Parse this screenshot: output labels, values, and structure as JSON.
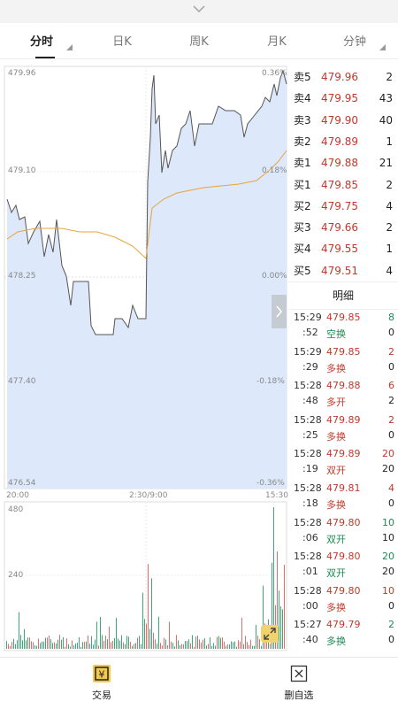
{
  "tabs": {
    "items": [
      {
        "label": "分时"
      },
      {
        "label": "日K"
      },
      {
        "label": "周K"
      },
      {
        "label": "月K"
      },
      {
        "label": "分钟"
      }
    ]
  },
  "chart": {
    "price_labels": [
      "479.96",
      "479.10",
      "478.25",
      "477.40",
      "476.54"
    ],
    "pct_labels": [
      "0.36%",
      "0.18%",
      "0.00%",
      "-0.18%",
      "-0.36%"
    ],
    "time_labels": [
      "20:00",
      "2:30/9:00",
      "15:30"
    ],
    "volume_labels": [
      "480",
      "240"
    ]
  },
  "orderbook": [
    {
      "label": "卖5",
      "price": "479.96",
      "vol": "2"
    },
    {
      "label": "卖4",
      "price": "479.95",
      "vol": "43"
    },
    {
      "label": "卖3",
      "price": "479.90",
      "vol": "40"
    },
    {
      "label": "卖2",
      "price": "479.89",
      "vol": "1"
    },
    {
      "label": "卖1",
      "price": "479.88",
      "vol": "21"
    },
    {
      "label": "买1",
      "price": "479.85",
      "vol": "2"
    },
    {
      "label": "买2",
      "price": "479.75",
      "vol": "4"
    },
    {
      "label": "买3",
      "price": "479.66",
      "vol": "2"
    },
    {
      "label": "买4",
      "price": "479.55",
      "vol": "1"
    },
    {
      "label": "买5",
      "price": "479.51",
      "vol": "4"
    }
  ],
  "trades_title": "明细",
  "trades": [
    {
      "t1": "15:29",
      "t2": ":52",
      "price": "479.85",
      "type": "空换",
      "v1": "8",
      "v2": "0",
      "type_color": "green",
      "v1_color": "green"
    },
    {
      "t1": "15:29",
      "t2": ":29",
      "price": "479.85",
      "type": "多换",
      "v1": "2",
      "v2": "0",
      "type_color": "red",
      "v1_color": "red"
    },
    {
      "t1": "15:28",
      "t2": ":48",
      "price": "479.88",
      "type": "多开",
      "v1": "6",
      "v2": "2",
      "type_color": "red",
      "v1_color": "red"
    },
    {
      "t1": "15:28",
      "t2": ":25",
      "price": "479.89",
      "type": "多换",
      "v1": "2",
      "v2": "0",
      "type_color": "red",
      "v1_color": "red"
    },
    {
      "t1": "15:28",
      "t2": ":19",
      "price": "479.89",
      "type": "双开",
      "v1": "20",
      "v2": "20",
      "type_color": "red",
      "v1_color": "red"
    },
    {
      "t1": "15:28",
      "t2": ":18",
      "price": "479.81",
      "type": "多换",
      "v1": "4",
      "v2": "0",
      "type_color": "red",
      "v1_color": "red"
    },
    {
      "t1": "15:28",
      "t2": ":06",
      "price": "479.80",
      "type": "双开",
      "v1": "10",
      "v2": "10",
      "type_color": "green",
      "v1_color": "green"
    },
    {
      "t1": "15:28",
      "t2": ":01",
      "price": "479.80",
      "type": "双开",
      "v1": "20",
      "v2": "20",
      "type_color": "green",
      "v1_color": "green"
    },
    {
      "t1": "15:28",
      "t2": ":00",
      "price": "479.80",
      "type": "多换",
      "v1": "10",
      "v2": "0",
      "type_color": "red",
      "v1_color": "red"
    },
    {
      "t1": "15:27",
      "t2": ":40",
      "price": "479.79",
      "type": "多换",
      "v1": "2",
      "v2": "0",
      "type_color": "green",
      "v1_color": "green"
    }
  ],
  "bottom_nav": {
    "trade_label": "交易",
    "trade_icon_text": "¥",
    "remove_label": "删自选"
  },
  "colors": {
    "up": "#c0392b",
    "down": "#1e8a55",
    "area_fill": "#dde9fb",
    "avg_line": "#e8a33d"
  }
}
